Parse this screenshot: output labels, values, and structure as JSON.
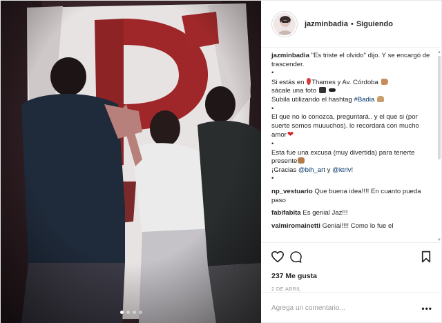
{
  "post": {
    "username": "jazminbadia",
    "separator": "•",
    "follow_status": "Siguiendo",
    "carousel": {
      "count": 4,
      "active": 0
    },
    "caption": {
      "username": "jazminbadia",
      "lines": [
        "\"Es triste el olvido\" dijo. Y se encargó de trascender.",
        "•",
        "Si estás en",
        "Thames y Av. Córdoba",
        "sácale una foto",
        "Subila utilizando el hashtag",
        "#Badia",
        "•",
        "El que no lo conozca, preguntará.. y el que si (por suerte somos muuuchos). lo recordará con mucho amor",
        "•",
        "Esta fue una excusa (muy divertida) para tenerte presente",
        "¡Gracias",
        "@bih_art",
        "y",
        "@ktrlv",
        "!",
        "•"
      ]
    },
    "comments": [
      {
        "username": "np_vestuario",
        "text": "Que buena idea!!!! En cuanto pueda paso"
      },
      {
        "username": "fabifabita",
        "text": "Es genial Jaz!!!"
      },
      {
        "username": "valmiromainetti",
        "text": "Genial!!!! Como lo fue el"
      }
    ],
    "likes": "237 Me gusta",
    "date": "2 DE ABRIL",
    "comment_placeholder": "Agrega un comentario...",
    "more_label": "•••",
    "icons": {
      "like": "heart-outline-icon",
      "comment": "speech-bubble-icon",
      "save": "bookmark-icon",
      "scroll_up": "triangle-up-icon",
      "scroll_down": "triangle-down-icon"
    },
    "colors": {
      "link": "#003569",
      "meta_gray": "#999999",
      "text": "#262626",
      "heart_emoji": "#d4232f"
    }
  }
}
